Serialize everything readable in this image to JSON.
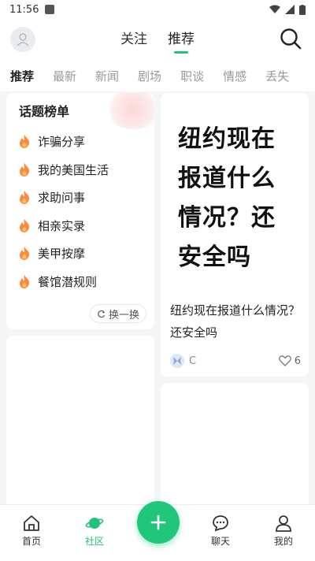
{
  "status_bar": {
    "time": "11:56"
  },
  "top_nav": {
    "tabs": [
      {
        "label": "关注",
        "active": false
      },
      {
        "label": "推荐",
        "active": true
      }
    ]
  },
  "categories": [
    "推荐",
    "最新",
    "新闻",
    "剧场",
    "职谈",
    "情感",
    "丢失"
  ],
  "topics": {
    "title": "话题榜单",
    "items": [
      "诈骗分享",
      "我的美国生活",
      "求助问事",
      "相亲实录",
      "美甲按摩",
      "餐馆潜规则"
    ],
    "refresh_label": "换一换"
  },
  "post": {
    "image_text": "纽约现在报道什么情况？还安全吗",
    "caption": "纽约现在报道什么情况？还安全吗",
    "author": "C",
    "likes": "6"
  },
  "bottom_nav": {
    "items": [
      {
        "label": "首页",
        "icon": "home-icon",
        "active": false
      },
      {
        "label": "社区",
        "icon": "planet-icon",
        "active": true
      },
      {
        "label": "聊天",
        "icon": "chat-icon",
        "active": false
      },
      {
        "label": "我的",
        "icon": "user-icon",
        "active": false
      }
    ]
  },
  "colors": {
    "accent": "#21c27a",
    "fab": "#20c77b",
    "flame": "#ff8a3d"
  }
}
